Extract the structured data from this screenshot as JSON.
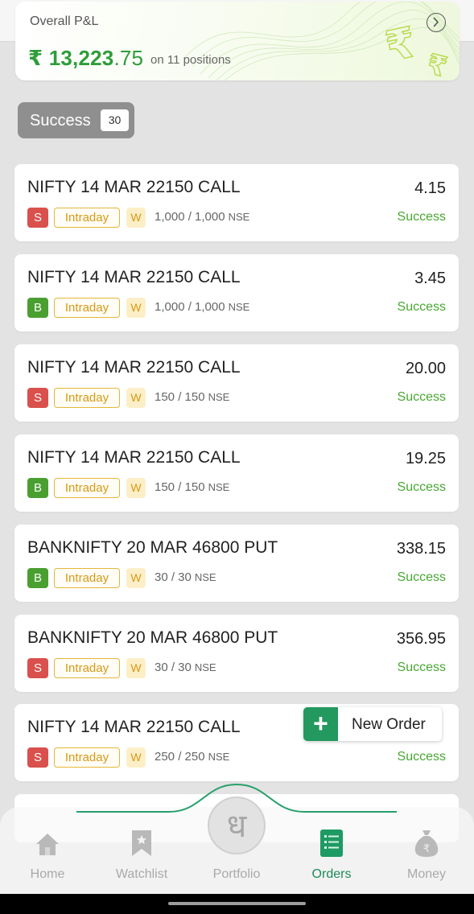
{
  "pnl": {
    "title": "Overall P&L",
    "currency": "₹",
    "amount_int": "13,223",
    "amount_dec": ".75",
    "positions_text": "on 11 positions"
  },
  "filter_chip": {
    "label": "Success",
    "count": "30"
  },
  "orders": [
    {
      "name": "NIFTY 14 MAR 22150 CALL",
      "price": "4.15",
      "side": "S",
      "product": "Intraday",
      "validity": "W",
      "qty": "1,000 / 1,000",
      "exchange": "NSE",
      "status": "Success"
    },
    {
      "name": "NIFTY 14 MAR 22150 CALL",
      "price": "3.45",
      "side": "B",
      "product": "Intraday",
      "validity": "W",
      "qty": "1,000 / 1,000",
      "exchange": "NSE",
      "status": "Success"
    },
    {
      "name": "NIFTY 14 MAR 22150 CALL",
      "price": "20.00",
      "side": "S",
      "product": "Intraday",
      "validity": "W",
      "qty": "150 / 150",
      "exchange": "NSE",
      "status": "Success"
    },
    {
      "name": "NIFTY 14 MAR 22150 CALL",
      "price": "19.25",
      "side": "B",
      "product": "Intraday",
      "validity": "W",
      "qty": "150 / 150",
      "exchange": "NSE",
      "status": "Success"
    },
    {
      "name": "BANKNIFTY 20 MAR 46800 PUT",
      "price": "338.15",
      "side": "B",
      "product": "Intraday",
      "validity": "W",
      "qty": "30 / 30",
      "exchange": "NSE",
      "status": "Success"
    },
    {
      "name": "BANKNIFTY 20 MAR 46800 PUT",
      "price": "356.95",
      "side": "S",
      "product": "Intraday",
      "validity": "W",
      "qty": "30 / 30",
      "exchange": "NSE",
      "status": "Success"
    },
    {
      "name": "NIFTY 14 MAR 22150 CALL",
      "price": "",
      "side": "S",
      "product": "Intraday",
      "validity": "W",
      "qty": "250 / 250",
      "exchange": "NSE",
      "status": "Success"
    }
  ],
  "new_order": {
    "plus": "+",
    "label": "New Order"
  },
  "nav": {
    "home": "Home",
    "watchlist": "Watchlist",
    "portfolio": "Portfolio",
    "portfolio_glyph": "ध",
    "orders": "Orders",
    "money": "Money"
  },
  "colors": {
    "brand_green": "#1e8a5a",
    "profit_green": "#2e9d3a",
    "sell_red": "#d9504c",
    "buy_green": "#4a9f31",
    "intraday_amber": "#d69a16"
  },
  "icons": {
    "home": "home-icon",
    "watchlist": "bookmark-icon",
    "portfolio": "portfolio-icon",
    "orders": "orders-list-icon",
    "money": "money-bag-icon",
    "pnl": "chevron-right-icon"
  }
}
